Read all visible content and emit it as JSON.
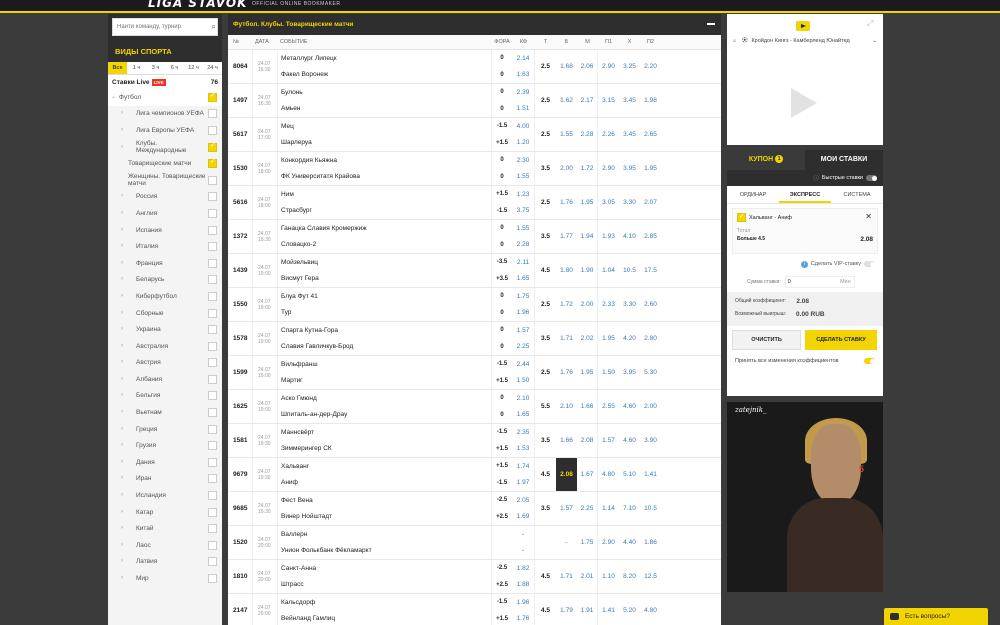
{
  "header": {
    "logo": "LIGA STAVOK",
    "subtitle": "OFFICIAL ONLINE BOOKMAKER"
  },
  "sidebar": {
    "search_placeholder": "Найти команду, турнир",
    "title": "ВИДЫ СПОРТА",
    "times": [
      "Все",
      "1 ч",
      "3 ч",
      "6 ч",
      "12 ч",
      "24 ч"
    ],
    "live_label": "Ставки Live",
    "live_badge": "LIVE",
    "live_count": "76",
    "items": [
      {
        "label": "Футбол",
        "level": 1,
        "checked": true
      },
      {
        "label": "Лига чемпионов УЕФА",
        "level": 2,
        "checked": false
      },
      {
        "label": "Лига Европы УЕФА",
        "level": 2,
        "checked": false
      },
      {
        "label": "Клубы. Международные",
        "level": 2,
        "checked": true
      },
      {
        "label": "Товарищеские матчи",
        "level": 3,
        "checked": true
      },
      {
        "label": "Женщины. Товарищеские матчи",
        "level": 3,
        "checked": false
      },
      {
        "label": "Россия",
        "level": 2,
        "checked": false
      },
      {
        "label": "Англия",
        "level": 2,
        "checked": false
      },
      {
        "label": "Испания",
        "level": 2,
        "checked": false
      },
      {
        "label": "Италия",
        "level": 2,
        "checked": false
      },
      {
        "label": "Франция",
        "level": 2,
        "checked": false
      },
      {
        "label": "Беларусь",
        "level": 2,
        "checked": false
      },
      {
        "label": "Киберфутбол",
        "level": 2,
        "checked": false
      },
      {
        "label": "Сборные",
        "level": 2,
        "checked": false
      },
      {
        "label": "Украина",
        "level": 2,
        "checked": false
      },
      {
        "label": "Австралия",
        "level": 2,
        "checked": false
      },
      {
        "label": "Австрия",
        "level": 2,
        "checked": false
      },
      {
        "label": "Албания",
        "level": 2,
        "checked": false
      },
      {
        "label": "Бельгия",
        "level": 2,
        "checked": false
      },
      {
        "label": "Вьетнам",
        "level": 2,
        "checked": false
      },
      {
        "label": "Греция",
        "level": 2,
        "checked": false
      },
      {
        "label": "Грузия",
        "level": 2,
        "checked": false
      },
      {
        "label": "Дания",
        "level": 2,
        "checked": false
      },
      {
        "label": "Иран",
        "level": 2,
        "checked": false
      },
      {
        "label": "Исландия",
        "level": 2,
        "checked": false
      },
      {
        "label": "Катар",
        "level": 2,
        "checked": false
      },
      {
        "label": "Китай",
        "level": 2,
        "checked": false
      },
      {
        "label": "Лаос",
        "level": 2,
        "checked": false
      },
      {
        "label": "Латвия",
        "level": 2,
        "checked": false
      },
      {
        "label": "Мир",
        "level": 2,
        "checked": false
      }
    ]
  },
  "main": {
    "title": "Футбол. Клубы. Товарищеские матчи",
    "columns": [
      "№",
      "ДАТА",
      "СОБЫТИЕ",
      "ФОРА",
      "КФ",
      "Т",
      "Б",
      "М",
      "П1",
      "Х",
      "П2"
    ],
    "rows": [
      {
        "no": "8064",
        "d": "24.07",
        "t": "16:30",
        "h": "Металлург Липецк",
        "a": "Факел Воронеж",
        "f1": "0",
        "f2": "0",
        "k1": "2.14",
        "k2": "1.63",
        "tot": "2.5",
        "b": "1.68",
        "m": "2.06",
        "p1": "2.90",
        "x": "3.25",
        "p2": "2.20"
      },
      {
        "no": "1497",
        "d": "24.07",
        "t": "16:30",
        "h": "Булонь",
        "a": "Амьен",
        "f1": "0",
        "f2": "0",
        "k1": "2.39",
        "k2": "1.51",
        "tot": "2.5",
        "b": "1.62",
        "m": "2.17",
        "p1": "3.15",
        "x": "3.45",
        "p2": "1.98"
      },
      {
        "no": "5617",
        "d": "24.07",
        "t": "17:00",
        "h": "Мец",
        "a": "Шарлеруа",
        "f1": "-1.5",
        "f2": "+1.5",
        "k1": "4.00",
        "k2": "1.20",
        "tot": "2.5",
        "b": "1.55",
        "m": "2.28",
        "p1": "2.26",
        "x": "3.45",
        "p2": "2.65"
      },
      {
        "no": "1530",
        "d": "24.07",
        "t": "18:00",
        "h": "Конкордия Кьяжна",
        "a": "ФК Университатя Крайова",
        "f1": "0",
        "f2": "0",
        "k1": "2.30",
        "k2": "1.55",
        "tot": "3.5",
        "b": "2.00",
        "m": "1.72",
        "p1": "2.90",
        "x": "3.95",
        "p2": "1.95"
      },
      {
        "no": "5616",
        "d": "24.07",
        "t": "18:00",
        "h": "Ним",
        "a": "Страсбург",
        "f1": "+1.5",
        "f2": "-1.5",
        "k1": "1.23",
        "k2": "3.75",
        "tot": "2.5",
        "b": "1.76",
        "m": "1.95",
        "p1": "3.05",
        "x": "3.30",
        "p2": "2.07"
      },
      {
        "no": "1372",
        "d": "24.07",
        "t": "18:30",
        "h": "Ганацка Славия Кромержиж",
        "a": "Словацко-2",
        "f1": "0",
        "f2": "0",
        "k1": "1.55",
        "k2": "2.28",
        "tot": "3.5",
        "b": "1.77",
        "m": "1.94",
        "p1": "1.93",
        "x": "4.10",
        "p2": "2.85"
      },
      {
        "no": "1439",
        "d": "24.07",
        "t": "19:00",
        "h": "Мойзельвиц",
        "a": "Висмут Гера",
        "f1": "-3.5",
        "f2": "+3.5",
        "k1": "2.11",
        "k2": "1.65",
        "tot": "4.5",
        "b": "1.80",
        "m": "1.90",
        "p1": "1.04",
        "x": "10.5",
        "p2": "17.5"
      },
      {
        "no": "1550",
        "d": "24.07",
        "t": "19:00",
        "h": "Блуа Фут 41",
        "a": "Тур",
        "f1": "0",
        "f2": "0",
        "k1": "1.75",
        "k2": "1.96",
        "tot": "2.5",
        "b": "1.72",
        "m": "2.00",
        "p1": "2.33",
        "x": "3.30",
        "p2": "2.60"
      },
      {
        "no": "1578",
        "d": "24.07",
        "t": "19:00",
        "h": "Спарта Кутна-Гора",
        "a": "Славия Гавличкув-Брод",
        "f1": "0",
        "f2": "0",
        "k1": "1.57",
        "k2": "2.25",
        "tot": "3.5",
        "b": "1.71",
        "m": "2.02",
        "p1": "1.95",
        "x": "4.20",
        "p2": "2.80"
      },
      {
        "no": "1599",
        "d": "24.07",
        "t": "19:00",
        "h": "Вильфранш",
        "a": "Мартиг",
        "f1": "-1.5",
        "f2": "+1.5",
        "k1": "2.44",
        "k2": "1.50",
        "tot": "2.5",
        "b": "1.76",
        "m": "1.95",
        "p1": "1.50",
        "x": "3.95",
        "p2": "5.30"
      },
      {
        "no": "1625",
        "d": "24.07",
        "t": "19:00",
        "h": "Аско Гмюнд",
        "a": "Шпиталь-ан-дер-Драу",
        "f1": "0",
        "f2": "0",
        "k1": "2.10",
        "k2": "1.65",
        "tot": "5.5",
        "b": "2.10",
        "m": "1.66",
        "p1": "2.55",
        "x": "4.60",
        "p2": "2.00"
      },
      {
        "no": "1581",
        "d": "24.07",
        "t": "19:30",
        "h": "Маннсвёрт",
        "a": "Зиммерингер СК",
        "f1": "-1.5",
        "f2": "+1.5",
        "k1": "2.35",
        "k2": "1.53",
        "tot": "3.5",
        "b": "1.66",
        "m": "2.08",
        "p1": "1.57",
        "x": "4.60",
        "p2": "3.90"
      },
      {
        "no": "9679",
        "d": "24.07",
        "t": "19:30",
        "h": "Хальванг",
        "a": "Аниф",
        "f1": "+1.5",
        "f2": "-1.5",
        "k1": "1.74",
        "k2": "1.97",
        "tot": "4.5",
        "b": "2.08",
        "m": "1.67",
        "p1": "4.80",
        "x": "5.10",
        "p2": "1.41",
        "sel": true
      },
      {
        "no": "9685",
        "d": "24.07",
        "t": "19:30",
        "h": "Фест Вена",
        "a": "Винер Нойштадт",
        "f1": "-2.5",
        "f2": "+2.5",
        "k1": "2.05",
        "k2": "1.69",
        "tot": "3.5",
        "b": "1.57",
        "m": "2.25",
        "p1": "1.14",
        "x": "7.10",
        "p2": "10.5"
      },
      {
        "no": "1520",
        "d": "24.07",
        "t": "20:00",
        "h": "Валлерн",
        "a": "Унион Фолькбанк Фёкламаркт",
        "f1": "",
        "f2": "",
        "k1": "-",
        "k2": "-",
        "tot": "",
        "b": "-",
        "m": "1.75",
        "p1": "2.90",
        "x": "4.40",
        "p2": "1.86"
      },
      {
        "no": "1810",
        "d": "24.07",
        "t": "20:00",
        "h": "Санкт-Анна",
        "a": "Штрасс",
        "f1": "-2.5",
        "f2": "+2.5",
        "k1": "1.82",
        "k2": "1.88",
        "tot": "4.5",
        "b": "1.71",
        "m": "2.01",
        "p1": "1.10",
        "x": "8.20",
        "p2": "12.5"
      },
      {
        "no": "2147",
        "d": "24.07",
        "t": "20:00",
        "h": "Кальсдорф",
        "a": "Вейнланд Гамлиц",
        "f1": "-1.5",
        "f2": "+1.5",
        "k1": "1.96",
        "k2": "1.76",
        "tot": "4.5",
        "b": "1.79",
        "m": "1.91",
        "p1": "1.41",
        "x": "5.20",
        "p2": "4.80"
      }
    ]
  },
  "video": {
    "match": "Кройдон Кингз - Камберленд Юнайтед"
  },
  "coupon": {
    "tab_coupon": "КУПОН",
    "tab_count": "1",
    "tab_my": "МОИ СТАВКИ",
    "fast_bets": "Быстрые ставки",
    "types": [
      "ОРДИНАР",
      "ЭКСПРЕСС",
      "СИСТЕМА"
    ],
    "bet_title": "Хальванг - Аниф",
    "bet_kind": "Тотал",
    "bet_pick": "Больше 4.5",
    "bet_odd": "2.08",
    "vip": "Сделать VIP-ставку",
    "amount_label": "Сумма ставки:",
    "amount_value": "0",
    "amount_min": "Мин",
    "total_label": "Общий коэффициент:",
    "total_value": "2.08",
    "win_label": "Возможный выигрыш:",
    "win_value": "0.00 RUB",
    "clear": "ОЧИСТИТЬ",
    "make": "СДЕЛАТЬ СТАВКУ",
    "accept": "Принять все изменения коэффициентов"
  },
  "stream": {
    "name": "zatejnik_",
    "overlay": "5"
  },
  "help": {
    "label": "Есть вопросы?"
  },
  "colors": {
    "accent": "#f2d400",
    "dark": "#2e2e2e",
    "odds": "#3a78b8"
  }
}
